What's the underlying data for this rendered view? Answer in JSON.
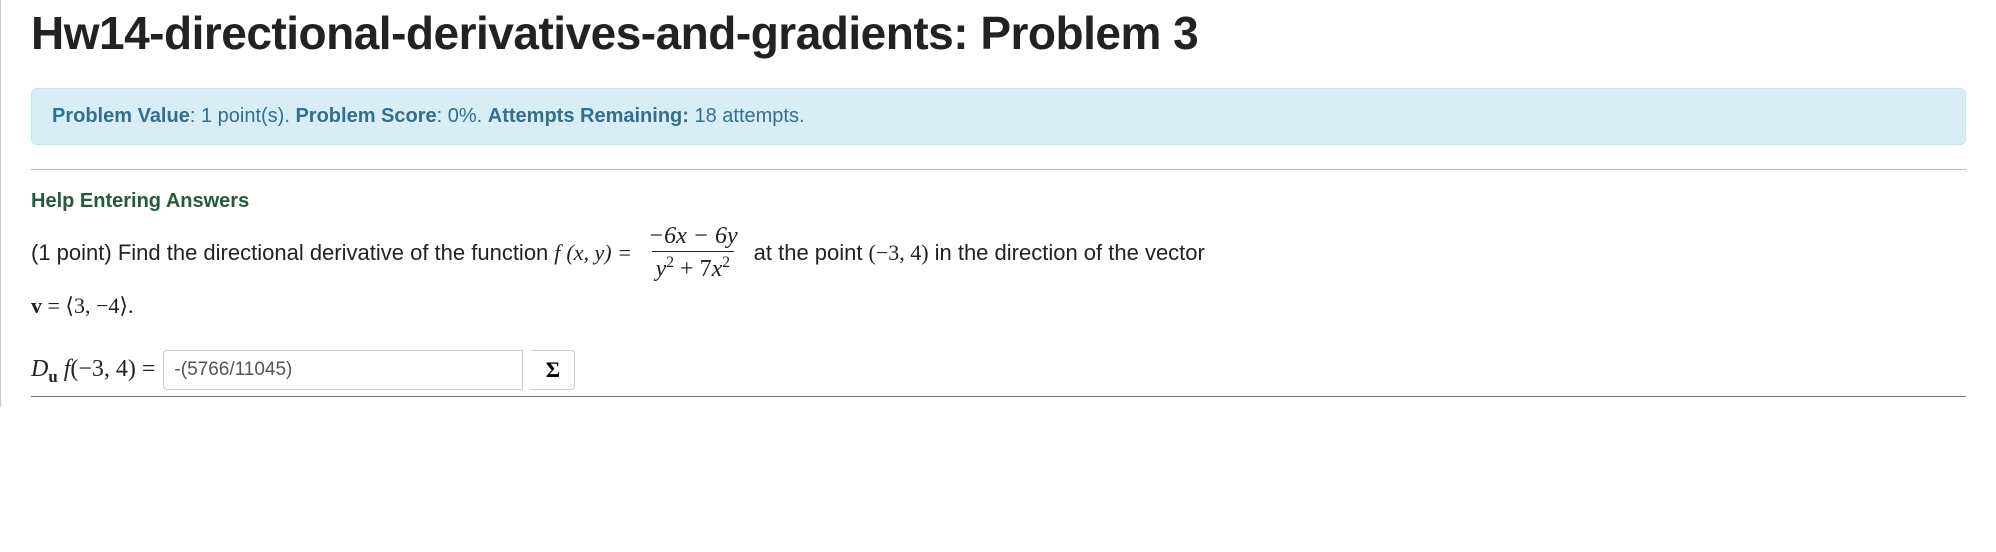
{
  "title": "Hw14-directional-derivatives-and-gradients: Problem 3",
  "alert": {
    "label_value": "Problem Value",
    "value": "1 point(s).",
    "label_score": "Problem Score",
    "score": "0%.",
    "label_attempts": "Attempts Remaining:",
    "attempts": "18 attempts."
  },
  "help_link": "Help Entering Answers",
  "problem": {
    "prefix": "(1 point) Find the directional derivative of the function ",
    "func_lhs_f": "f",
    "func_lhs_args": "(x, y) = ",
    "frac_num": "−6x − 6y",
    "frac_den_a": "y",
    "frac_den_plus": " + 7",
    "frac_den_b": "x",
    "mid": " at the point ",
    "point": "(−3, 4)",
    "suffix": " in the direction of the vector",
    "vec_lhs": "v",
    "vec_eq": " = ⟨3, −4⟩.",
    "answer_label_D": "D",
    "answer_label_u": "u",
    "answer_label_f": " f",
    "answer_label_args": "(−3, 4) = ",
    "answer_value": "-(5766/11045)",
    "sigma": "Σ"
  }
}
